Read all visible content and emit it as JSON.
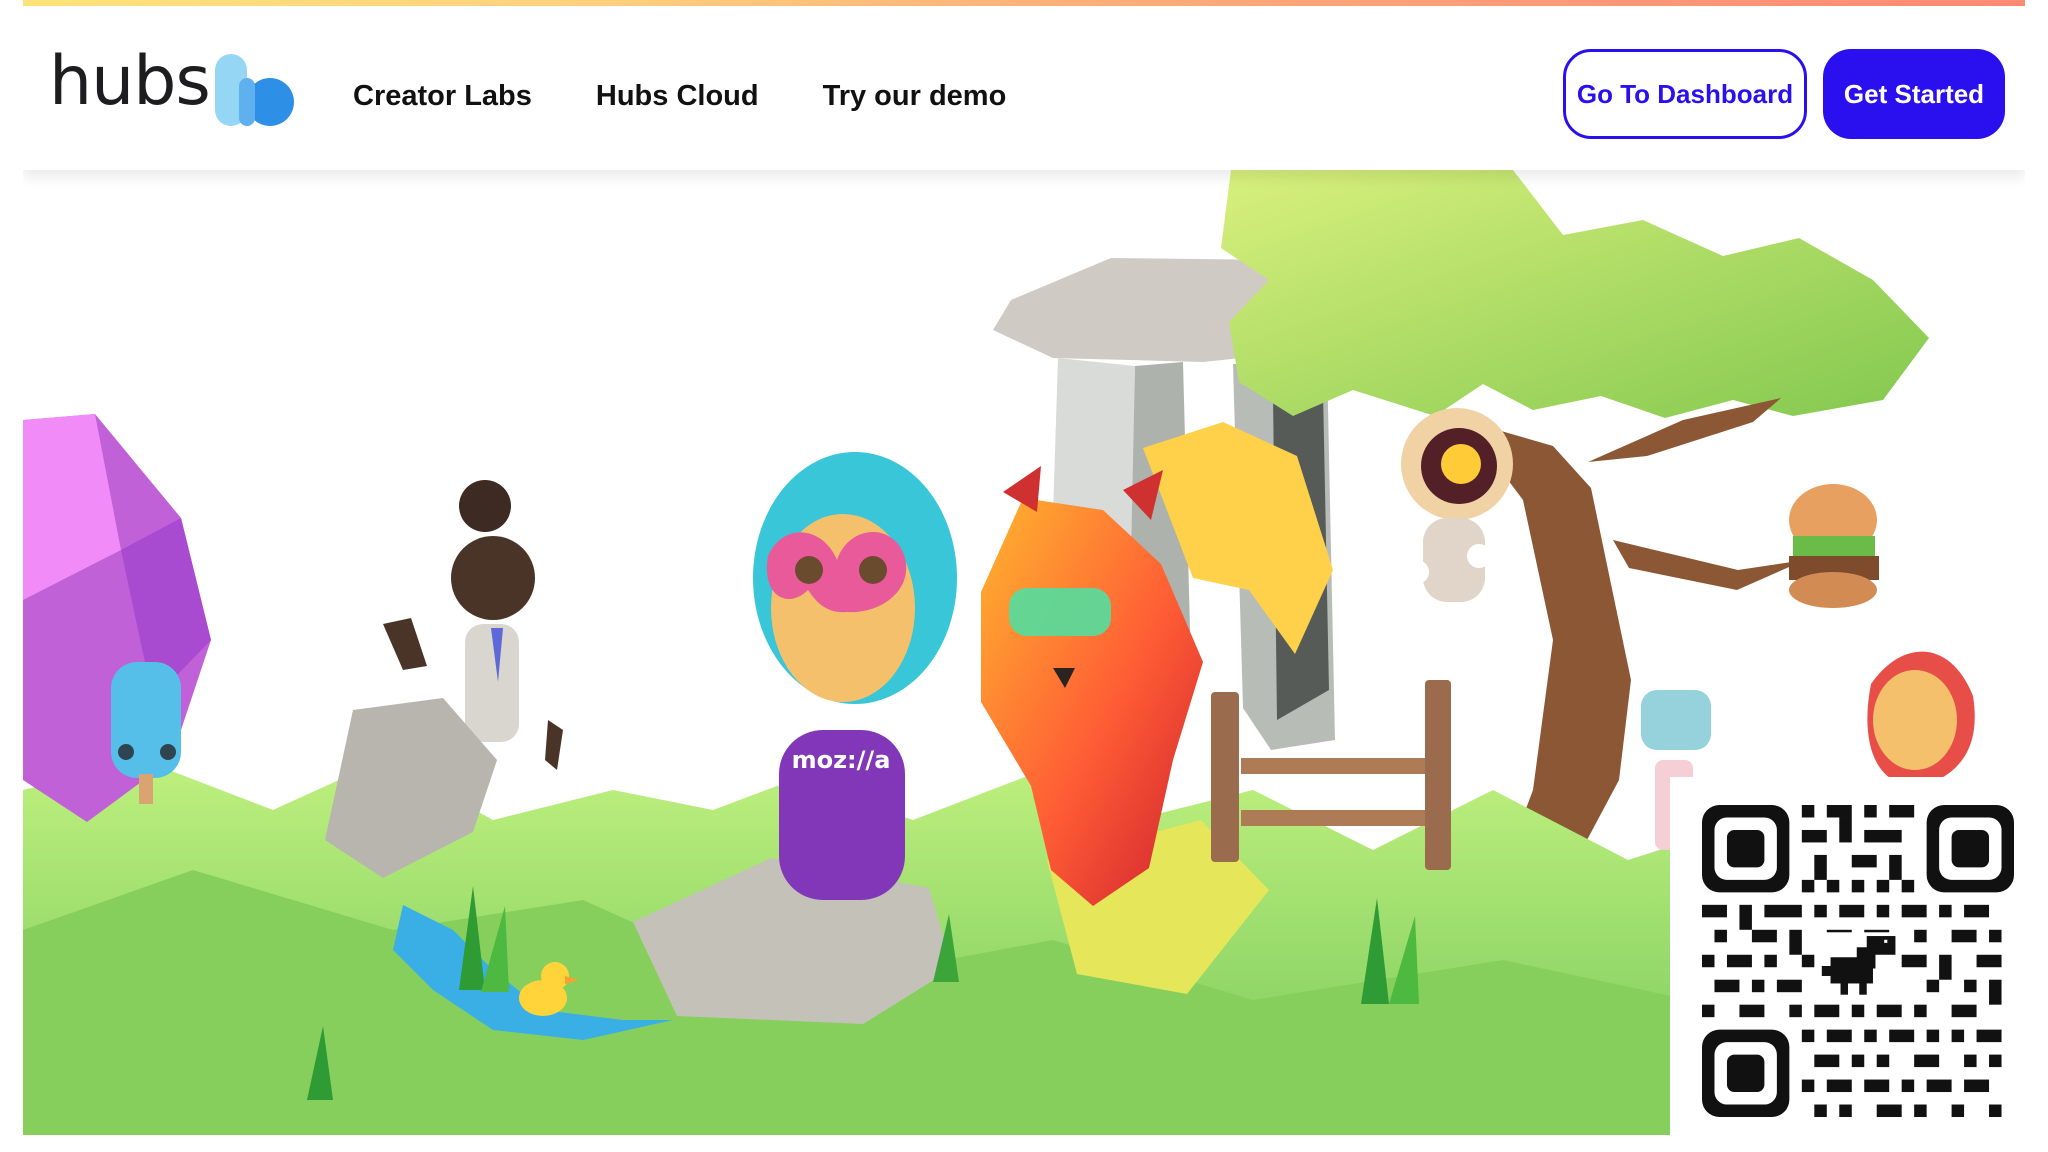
{
  "brand": {
    "name": "hubs"
  },
  "nav": {
    "items": [
      {
        "label": "Creator Labs"
      },
      {
        "label": "Hubs Cloud"
      },
      {
        "label": "Try our demo"
      }
    ]
  },
  "actions": {
    "dashboard_label": "Go To Dashboard",
    "get_started_label": "Get Started"
  },
  "hero": {
    "shirt_text": "moz://a"
  },
  "colors": {
    "primary": "#2a10ef",
    "top_gradient": [
      "#ffe37a",
      "#ff8a74"
    ],
    "logo_light_blue": "#96d6f5",
    "logo_blue": "#2e8fe6"
  },
  "icons": {
    "logo_mark": "hubs-logo-icon",
    "qr": "qr-code-icon",
    "dinosaur": "dinosaur-icon"
  }
}
